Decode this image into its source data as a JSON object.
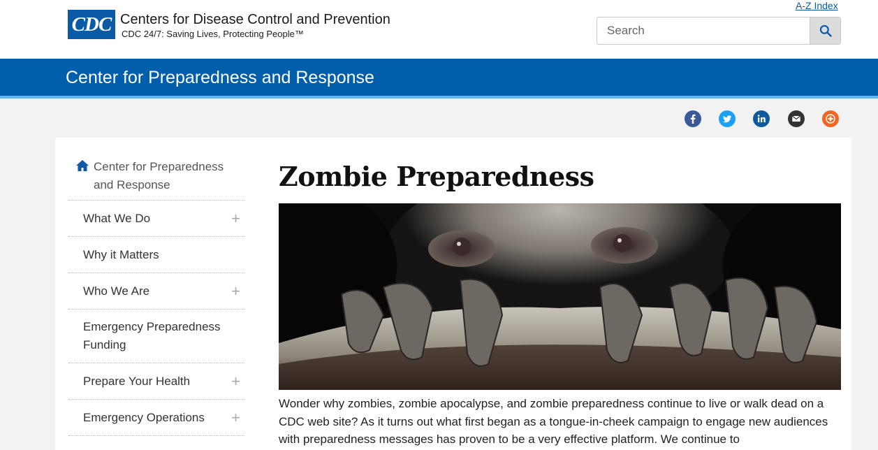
{
  "header": {
    "logo_text": "CDC",
    "org_name": "Centers for Disease Control and Prevention",
    "tagline": "CDC 24/7: Saving Lives, Protecting People™",
    "az_index": "A-Z Index",
    "search_placeholder": "Search"
  },
  "banner": {
    "title": "Center for Preparedness and Response"
  },
  "social": [
    {
      "name": "facebook-icon",
      "color": "#3b5998"
    },
    {
      "name": "twitter-icon",
      "color": "#1da1f2"
    },
    {
      "name": "linkedin-icon",
      "color": "#0e5a9c"
    },
    {
      "name": "email-icon",
      "color": "#333333"
    },
    {
      "name": "syndicate-icon",
      "color": "#f26522"
    }
  ],
  "sidenav": {
    "home_label": "Center for Preparedness and Response",
    "items": [
      {
        "label": "What We Do",
        "expandable": true
      },
      {
        "label": "Why it Matters",
        "expandable": false
      },
      {
        "label": "Who We Are",
        "expandable": true
      },
      {
        "label": "Emergency Preparedness Funding",
        "expandable": false
      },
      {
        "label": "Prepare Your Health",
        "expandable": true
      },
      {
        "label": "Emergency Operations",
        "expandable": true
      }
    ]
  },
  "main": {
    "title": "Zombie Preparedness",
    "intro": "Wonder why zombies, zombie apocalypse, and zombie preparedness continue to live or walk dead on a CDC web site? As it turns out what first began as a tongue-in-cheek campaign to engage new audiences with preparedness messages has proven to be a very effective platform. We continue to"
  },
  "colors": {
    "brand_blue": "#005eaa",
    "banner_border": "#6fb3e0"
  }
}
